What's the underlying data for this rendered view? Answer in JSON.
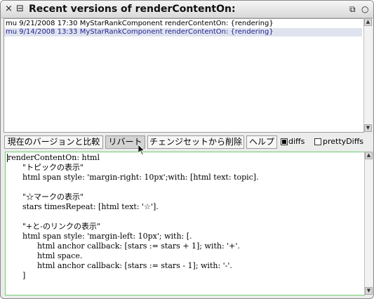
{
  "window": {
    "title": "Recent versions of renderContentOn:",
    "close_icon": "×",
    "menu_icon": "⊟",
    "collapse_icon": "⧉",
    "expand_icon": "○"
  },
  "versions": [
    {
      "text": "mu 9/21/2008 17:30 MyStarRankComponent renderContentOn: {rendering}",
      "selected": false
    },
    {
      "text": "mu 9/14/2008 13:33 MyStarRankComponent renderContentOn: {rendering}",
      "selected": true
    }
  ],
  "toolbar": {
    "compare_label": "現在のバージョンと比較",
    "revert_label": "リバート",
    "remove_changeset_label": "チェンジセットから削除",
    "help_label": "ヘルプ",
    "diffs_label": "diffs",
    "diffs_checked": true,
    "pretty_diffs_label": "prettyDiffs",
    "pretty_diffs_checked": false
  },
  "code_lines": [
    "renderContentOn: html",
    "      \"トピックの表示\"",
    "      html span style: 'margin-right: 10px';with: [html text: topic].",
    "",
    "      \"☆マークの表示\"",
    "      stars timesRepeat: [html text: '☆'].",
    "",
    "      \"+と-のリンクの表示\"",
    "      html span style: 'margin-left: 10px'; with: [.",
    "            html anchor callback: [stars := stars + 1]; with: '+'.",
    "            html space.",
    "            html anchor callback: [stars := stars - 1]; with: '-'.",
    "      ]"
  ],
  "colors": {
    "selection_bg": "#dfe3ef",
    "selection_text": "#23238e",
    "code_border": "#6fcf6f"
  }
}
